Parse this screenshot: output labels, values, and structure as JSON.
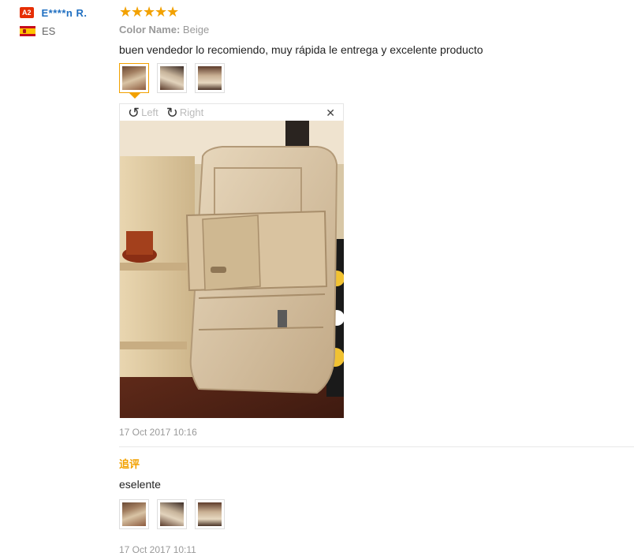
{
  "reviewer": {
    "badge": "A2",
    "name": "E****n R.",
    "country": "ES",
    "flag_icon": "spain-flag-icon"
  },
  "review": {
    "stars": [
      "★",
      "★",
      "★",
      "★",
      "★"
    ],
    "rating": 5,
    "star_color": "#f2a100",
    "color_label": "Color Name:",
    "color_value": "Beige",
    "text": "buen vendedor lo recomiendo, muy rápida le entrega y excelente producto",
    "thumbnails": [
      "photo-1",
      "photo-2",
      "photo-3"
    ],
    "viewer": {
      "rotate_left": "Left",
      "rotate_right": "Right",
      "rotate_left_icon": "rotate-left-icon",
      "rotate_right_icon": "rotate-right-icon",
      "close_icon": "close-icon"
    },
    "date": "17 Oct 2017 10:16"
  },
  "followup": {
    "label": "追评",
    "text": "eselente",
    "thumbnails": [
      "photo-1",
      "photo-2",
      "photo-3"
    ],
    "date": "17 Oct 2017 10:11"
  },
  "colors": {
    "accent": "#f2a100",
    "link": "#1f6fc1",
    "badge": "#e62e04"
  }
}
